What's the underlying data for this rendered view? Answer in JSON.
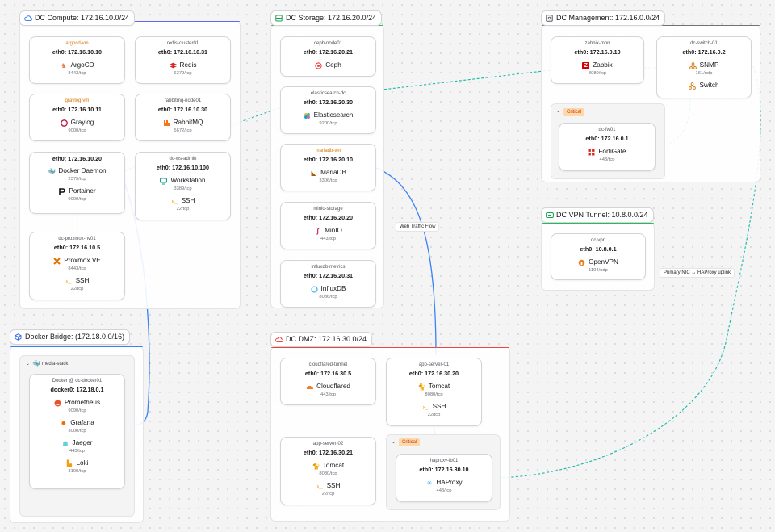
{
  "groups": {
    "compute": {
      "label": "DC Compute: 172.16.10.0/24",
      "accent": "#6366f1"
    },
    "storage": {
      "label": "DC Storage: 172.16.20.0/24",
      "accent": "#22c55e"
    },
    "management": {
      "label": "DC Management: 172.16.0.0/24",
      "accent": "#71717a"
    },
    "vpn": {
      "label": "DC VPN Tunnel: 10.8.0.0/24",
      "accent": "#22c55e"
    },
    "bridge": {
      "label": "Docker Bridge: (172.18.0.0/16)",
      "accent": "#3b82f6"
    },
    "dmz": {
      "label": "DC DMZ: 172.16.30.0/24",
      "accent": "#ef4444"
    }
  },
  "subgroups": {
    "mgmt_critical": {
      "badge": "Critical"
    },
    "dmz_critical": {
      "badge": "Critical"
    },
    "media_stack": {
      "label": "media-stack"
    }
  },
  "nodes": {
    "argocd_vm": {
      "name": "argocd-vm",
      "ip": "eth0: 172.16.10.10",
      "services": [
        {
          "label": "ArgoCD",
          "port": "8443/tcp"
        }
      ]
    },
    "redis_cluster01": {
      "name": "redis-cluster01",
      "ip": "eth0: 172.16.10.31",
      "services": [
        {
          "label": "Redis",
          "port": "6379/tcp"
        }
      ]
    },
    "graylog_vm": {
      "name": "graylog-vm",
      "ip": "eth0: 172.16.10.11",
      "services": [
        {
          "label": "Graylog",
          "port": "9000/tcp"
        }
      ]
    },
    "rabbitmq_node01": {
      "name": "rabbitmq-node01",
      "ip": "eth0: 172.16.10.30",
      "services": [
        {
          "label": "RabbitMQ",
          "port": "5672/tcp"
        }
      ]
    },
    "docker_host": {
      "name": "",
      "ip": "eth0: 172.16.10.20",
      "services": [
        {
          "label": "Docker Daemon",
          "port": "2375/tcp"
        },
        {
          "label": "Portainer",
          "port": "9000/tcp"
        }
      ]
    },
    "dc_ws_admin": {
      "name": "dc-ws-admin",
      "ip": "eth0: 172.16.10.100",
      "services": [
        {
          "label": "Workstation",
          "port": "3389/tcp"
        },
        {
          "label": "SSH",
          "port": "22/tcp"
        }
      ]
    },
    "dc_proxmox_hv01": {
      "name": "dc-proxmox-hv01",
      "ip": "eth0: 172.16.10.5",
      "services": [
        {
          "label": "Proxmox VE",
          "port": "8443/tcp"
        },
        {
          "label": "SSH",
          "port": "22/tcp"
        }
      ]
    },
    "ceph_node01": {
      "name": "ceph-node01",
      "ip": "eth0: 172.16.20.21",
      "services": [
        {
          "label": "Ceph",
          "port": ""
        }
      ]
    },
    "elasticsearch_dc": {
      "name": "elasticsearch-dc",
      "ip": "eth0: 172.16.20.30",
      "services": [
        {
          "label": "Elasticsearch",
          "port": "9200/tcp"
        }
      ]
    },
    "mariadb_vm": {
      "name": "mariadb-vm",
      "ip": "eth0: 172.16.20.10",
      "services": [
        {
          "label": "MariaDB",
          "port": "3306/tcp"
        }
      ]
    },
    "minio_storage": {
      "name": "minio-storage",
      "ip": "eth0: 172.16.20.20",
      "services": [
        {
          "label": "MinIO",
          "port": "443/tcp"
        }
      ]
    },
    "influxdb_metrics": {
      "name": "influxdb-metrics",
      "ip": "eth0: 172.16.20.31",
      "services": [
        {
          "label": "InfluxDB",
          "port": "8086/tcp"
        }
      ]
    },
    "zabbix_mon": {
      "name": "zabbix-mon",
      "ip": "eth0: 172.16.0.10",
      "services": [
        {
          "label": "Zabbix",
          "port": "8080/tcp"
        }
      ]
    },
    "dc_switch_01": {
      "name": "dc-switch-01",
      "ip": "eth0: 172.16.0.2",
      "services": [
        {
          "label": "SNMP",
          "port": "161/udp"
        },
        {
          "label": "Switch",
          "port": ""
        }
      ]
    },
    "dc_fw01": {
      "name": "dc-fw01",
      "ip": "eth0: 172.16.0.1",
      "services": [
        {
          "label": "FortiGate",
          "port": "443/tcp"
        }
      ]
    },
    "dc_vpn": {
      "name": "dc-vpn",
      "ip": "eth0: 10.8.0.1",
      "services": [
        {
          "label": "OpenVPN",
          "port": "1194/udp"
        }
      ]
    },
    "docker_dc_docker01": {
      "name": "Docker @ dc-docker01",
      "ip": "docker0: 172.18.0.1",
      "services": [
        {
          "label": "Prometheus",
          "port": "9090/tcp"
        },
        {
          "label": "Grafana",
          "port": "3000/tcp"
        },
        {
          "label": "Jaeger",
          "port": "443/tcp"
        },
        {
          "label": "Loki",
          "port": "3100/tcp"
        }
      ]
    },
    "cloudflared_tunnel": {
      "name": "cloudflared-tunnel",
      "ip": "eth0: 172.16.30.5",
      "services": [
        {
          "label": "Cloudflared",
          "port": "443/tcp"
        }
      ]
    },
    "app_server_01": {
      "name": "app-server-01",
      "ip": "eth0: 172.16.30.20",
      "services": [
        {
          "label": "Tomcat",
          "port": "8080/tcp"
        },
        {
          "label": "SSH",
          "port": "22/tcp"
        }
      ]
    },
    "app_server_02": {
      "name": "app-server-02",
      "ip": "eth0: 172.16.30.21",
      "services": [
        {
          "label": "Tomcat",
          "port": "8080/tcp"
        },
        {
          "label": "SSH",
          "port": "22/tcp"
        }
      ]
    },
    "haproxy_lb01": {
      "name": "haproxy-lb01",
      "ip": "eth0: 172.16.30.10",
      "services": [
        {
          "label": "HAProxy",
          "port": "443/tcp"
        }
      ]
    }
  },
  "edges": {
    "web_traffic_flow": "Web Traffic Flow",
    "primary_nic_uplink": "Primary NIC ↔ HAProxy uplink"
  },
  "colors": {
    "dashed_link": "#14b8a6",
    "solid_link": "#3b82f6",
    "warn_name": "#d97706",
    "critical_badge_bg": "#fed7aa"
  }
}
